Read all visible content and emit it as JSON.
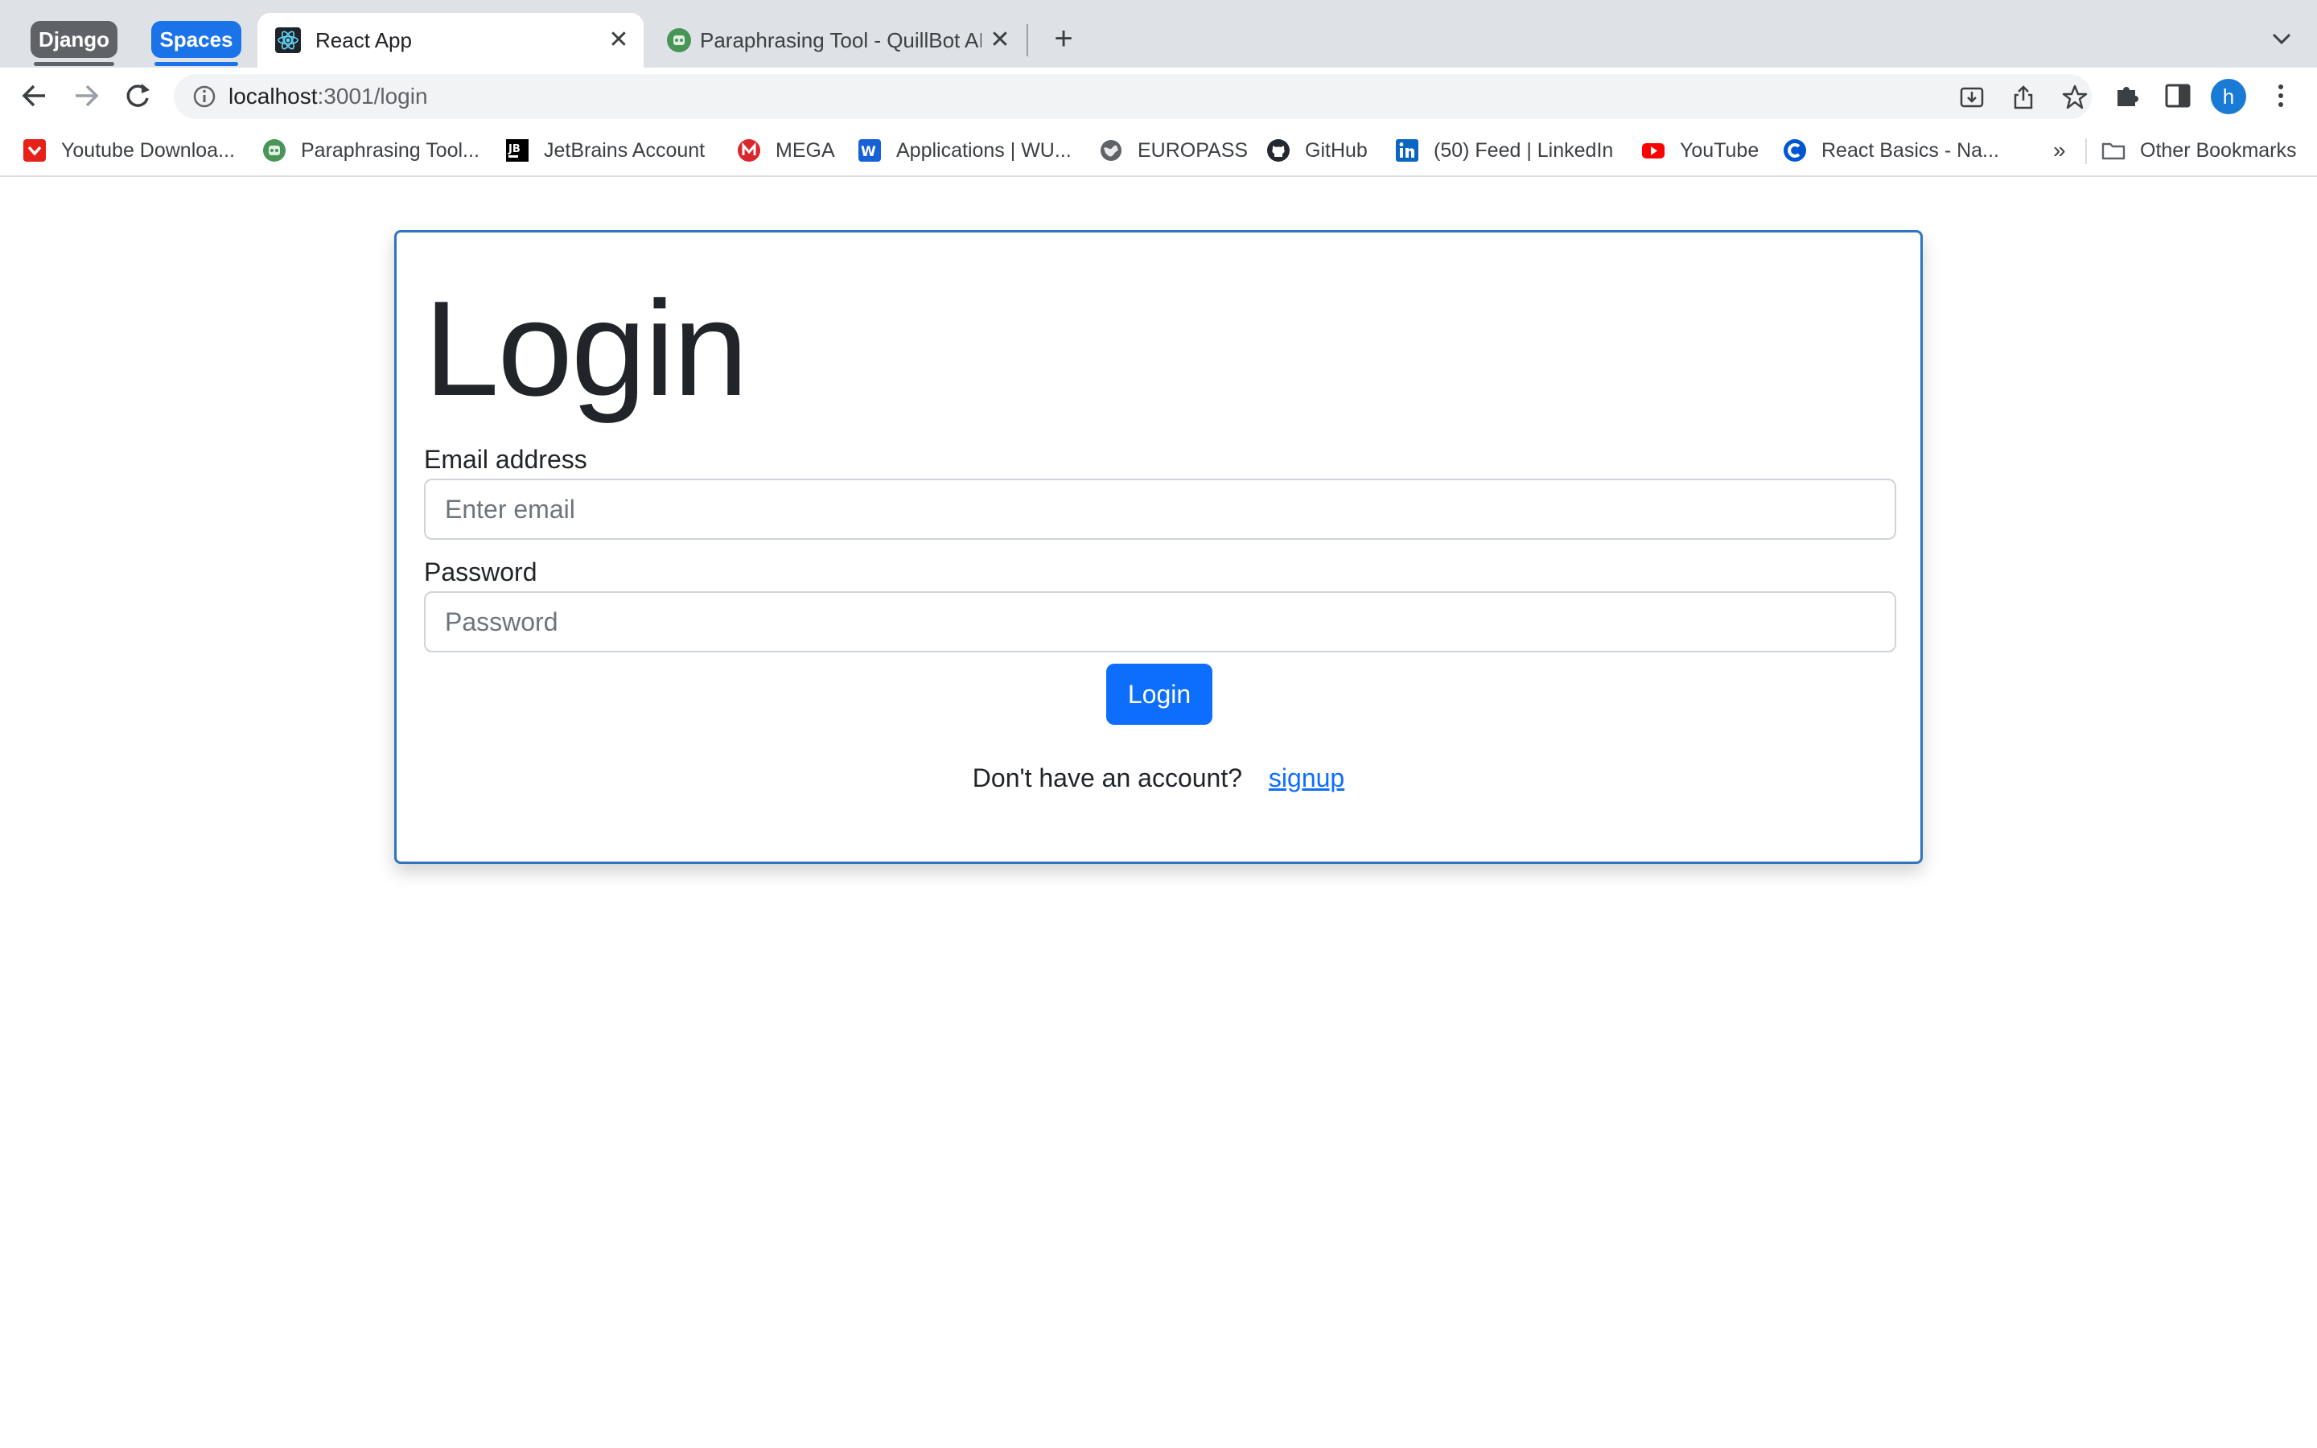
{
  "browser": {
    "tab_groups": [
      {
        "label": "Django",
        "color": "#5f6368"
      },
      {
        "label": "Spaces",
        "color": "#1a73e8"
      }
    ],
    "tabs": [
      {
        "title": "React App",
        "active": true,
        "icon": "react-icon"
      },
      {
        "title": "Paraphrasing Tool - QuillBot AI",
        "active": false,
        "icon": "quillbot-icon"
      }
    ],
    "new_tab_symbol": "+",
    "close_symbol": "✕",
    "url_host": "localhost",
    "url_rest": ":3001/login",
    "avatar_letter": "h"
  },
  "bookmarks": [
    {
      "label": "Youtube Downloa...",
      "icon": "youtube-downloader-icon"
    },
    {
      "label": "Paraphrasing Tool...",
      "icon": "quillbot-icon"
    },
    {
      "label": "JetBrains Account",
      "icon": "jetbrains-icon"
    },
    {
      "label": "MEGA",
      "icon": "mega-icon"
    },
    {
      "label": "Applications | WU...",
      "icon": "wu-icon"
    },
    {
      "label": "EUROPASS",
      "icon": "globe-icon"
    },
    {
      "label": "GitHub",
      "icon": "github-icon"
    },
    {
      "label": "(50) Feed | LinkedIn",
      "icon": "linkedin-icon"
    },
    {
      "label": "YouTube",
      "icon": "youtube-icon"
    },
    {
      "label": "React Basics - Na...",
      "icon": "coursera-icon"
    }
  ],
  "bookmarks_more": "»",
  "other_bookmarks": "Other Bookmarks",
  "page": {
    "title": "Login",
    "email_label": "Email address",
    "email_placeholder": "Enter email",
    "password_label": "Password",
    "password_placeholder": "Password",
    "submit_label": "Login",
    "signup_prompt": "Don't have an account?",
    "signup_link": "signup"
  },
  "colors": {
    "primary": "#0d6efd",
    "card_border": "#2f74c0"
  }
}
